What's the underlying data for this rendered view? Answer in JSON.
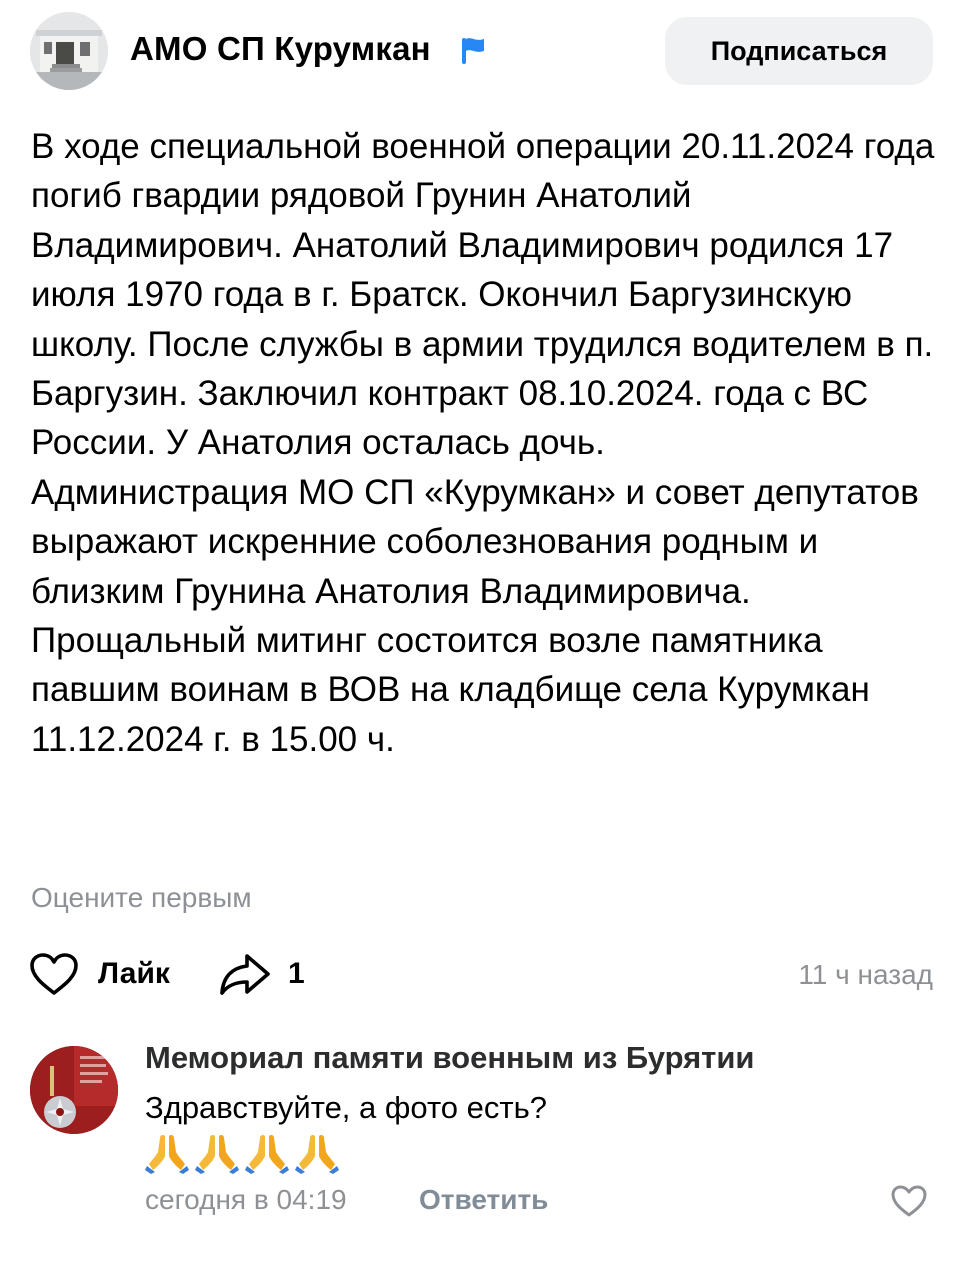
{
  "header": {
    "author": "АМО СП Курумкан",
    "subscribe_label": "Подписаться"
  },
  "post": {
    "paragraphs": [
      "В ходе специальной военной операции 20.11.2024 года погиб гвардии рядовой Грунин Анатолий Владимирович. Анатолий Владимирович родился 17 июля 1970 года в г. Братск. Окончил Баргузинскую школу. После службы в армии трудился водителем в п. Баргузин. Заключил контракт 08.10.2024. года с ВС России. У Анатолия осталась дочь.",
      "Администрация МО СП «Курумкан» и совет депутатов выражают искренние соболезнования родным и близким Грунина Анатолия Владимировича.",
      "Прощальный митинг состоится возле памятника павшим воинам в ВОВ на кладбище села Курумкан 11.12.2024 г. в 15.00 ч."
    ],
    "rate_first": "Оцените первым",
    "like_label": "Лайк",
    "share_count": "1",
    "time": "11 ч назад"
  },
  "comment": {
    "author": "Мемориал памяти военным из Бурятии",
    "text": "Здравствуйте, а фото есть?",
    "emoji_count": 4,
    "emoji_icon": "folded-hands-icon",
    "time": "сегодня в 04:19",
    "reply_label": "Ответить"
  },
  "colors": {
    "muted_text": "#8d9196",
    "reply_text": "#818c99",
    "button_bg": "#f0f1f3",
    "verified_flag": "#2787f5"
  }
}
